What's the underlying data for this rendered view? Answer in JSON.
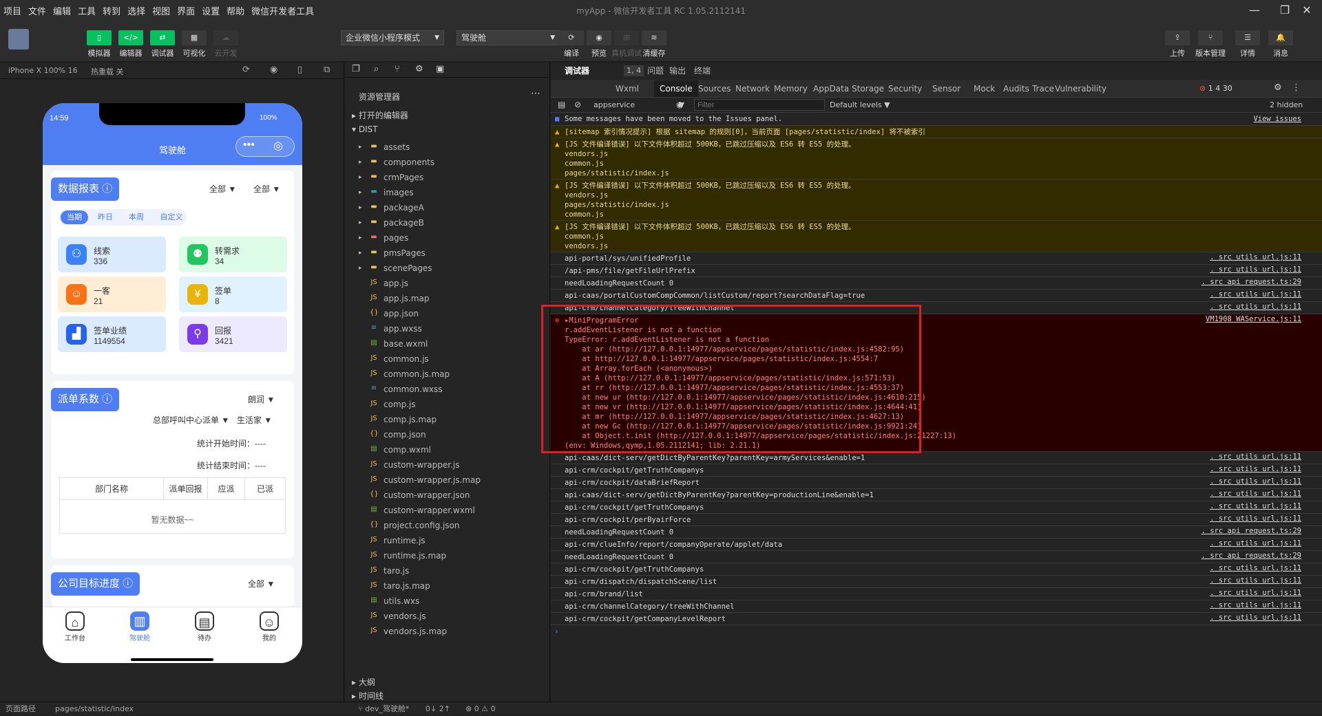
{
  "menu": [
    "项目",
    "文件",
    "编辑",
    "工具",
    "转到",
    "选择",
    "视图",
    "界面",
    "设置",
    "帮助",
    "微信开发者工具"
  ],
  "window_title": "myApp - 微信开发者工具 RC 1.05.2112141",
  "toolbar": {
    "left": [
      "模拟器",
      "编辑器",
      "调试器",
      "可视化",
      "云开发"
    ],
    "mode_select": "企业微信小程序模式",
    "page_select": "驾驶舱",
    "mid": [
      "编译",
      "预览",
      "真机调试",
      "清缓存"
    ],
    "right": [
      "上传",
      "版本管理",
      "详情",
      "消息"
    ]
  },
  "sim": {
    "device": "iPhone X 100% 16",
    "hotreload": "热重载 关",
    "time": "14:59",
    "battery": "100%",
    "nav_title": "驾驶舱",
    "report": {
      "title": "数据报表",
      "filters": [
        "全部",
        "全部"
      ],
      "tabs": [
        "当期",
        "昨日",
        "本周",
        "自定义"
      ],
      "kpis": [
        {
          "label": "线索",
          "value": "336"
        },
        {
          "label": "转需求",
          "value": "34"
        },
        {
          "label": "一客",
          "value": "21"
        },
        {
          "label": "签单",
          "value": "8"
        },
        {
          "label": "签单业绩",
          "value": "1149554"
        },
        {
          "label": "回报",
          "value": "3421"
        }
      ]
    },
    "dispatch": {
      "title": "派单系数",
      "f1": "朗润",
      "f2": "总部呼叫中心派单",
      "f3": "生活家",
      "start": "统计开始时间：----",
      "end": "统计结束时间：----",
      "cols": [
        "部门名称",
        "派单回报",
        "应派",
        "已派"
      ],
      "empty": "暂无数据~~"
    },
    "goal": {
      "title": "公司目标进度",
      "filter": "全部"
    },
    "tabbar": [
      "工作台",
      "驾驶舱",
      "待办",
      "我的"
    ]
  },
  "explorer": {
    "title": "资源管理器",
    "open_editors": "打开的编辑器",
    "root": "DIST",
    "items": [
      "assets",
      "components",
      "crmPages",
      "images",
      "packageA",
      "packageB",
      "pages",
      "pmsPages",
      "scenePages",
      "app.js",
      "app.js.map",
      "app.json",
      "app.wxss",
      "base.wxml",
      "common.js",
      "common.js.map",
      "common.wxss",
      "comp.js",
      "comp.js.map",
      "comp.json",
      "comp.wxml",
      "custom-wrapper.js",
      "custom-wrapper.js.map",
      "custom-wrapper.json",
      "custom-wrapper.wxml",
      "project.config.json",
      "runtime.js",
      "runtime.js.map",
      "taro.js",
      "taro.js.map",
      "utils.wxs",
      "vendors.js",
      "vendors.js.map"
    ],
    "outline": "大纲",
    "timeline": "时间线"
  },
  "devtools": {
    "toptabs": [
      "调试器",
      "1, 4",
      "问题",
      "输出",
      "终端"
    ],
    "tabs": [
      "Wxml",
      "Console",
      "Sources",
      "Network",
      "Memory",
      "AppData",
      "Storage",
      "Security",
      "Sensor",
      "Mock",
      "Audits",
      "Trace",
      "Vulnerability"
    ],
    "counts": "1  4  30",
    "context": "appservice",
    "filter_placeholder": "Filter",
    "levels": "Default levels",
    "hidden": "2 hidden",
    "issues_msg": "Some messages have been moved to the Issues panel.",
    "view_issues": "View issues",
    "logs": [
      {
        "t": "warn",
        "text": "[sitemap 索引情况提示] 根据 sitemap 的规则[0]，当前页面 [pages/statistic/index] 将不被索引",
        "src": ""
      },
      {
        "t": "warn",
        "text": "[JS 文件编译错误] 以下文件体积超过 500KB，已跳过压缩以及 ES6 转 ES5 的处理。\nvendors.js\ncommon.js\npages/statistic/index.js",
        "src": ""
      },
      {
        "t": "warn",
        "text": "[JS 文件编译错误] 以下文件体积超过 500KB，已跳过压缩以及 ES6 转 ES5 的处理。\nvendors.js\npages/statistic/index.js\ncommon.js",
        "src": ""
      },
      {
        "t": "warn",
        "text": "[JS 文件编译错误] 以下文件体积超过 500KB，已跳过压缩以及 ES6 转 ES5 的处理。\ncommon.js\nvendors.js",
        "src": ""
      },
      {
        "t": "log",
        "text": "api-portal/sys/unifiedProfile",
        "src": ". src utils url.js:11"
      },
      {
        "t": "log",
        "text": "/api-pms/file/getFileUrlPrefix",
        "src": ". src utils url.js:11"
      },
      {
        "t": "log",
        "text": "needLoadingRequestCount 0",
        "src": ". src api request.ts:29"
      },
      {
        "t": "log",
        "text": "api-caas/portalCustomCompCommon/listCustom/report?searchDataFlag=true",
        "src": ". src utils url.js:11"
      },
      {
        "t": "log",
        "text": "api-crm/channelCategory/treeWithChannel",
        "src": ". src utils url.js:11"
      },
      {
        "t": "err",
        "text": "▸MiniProgramError\nr.addEventListener is not a function\nTypeError: r.addEventListener is not a function\n    at ar (http://127.0.0.1:14977/appservice/pages/statistic/index.js:4582:95)\n    at http://127.0.0.1:14977/appservice/pages/statistic/index.js:4554:7\n    at Array.forEach (<anonymous>)\n    at A (http://127.0.0.1:14977/appservice/pages/statistic/index.js:571:53)\n    at rr (http://127.0.0.1:14977/appservice/pages/statistic/index.js:4553:37)\n    at new ur (http://127.0.0.1:14977/appservice/pages/statistic/index.js:4610:215)\n    at new vr (http://127.0.0.1:14977/appservice/pages/statistic/index.js:4644:41)\n    at mr (http://127.0.0.1:14977/appservice/pages/statistic/index.js:4627:13)\n    at new Gc (http://127.0.0.1:14977/appservice/pages/statistic/index.js:9921:24)\n    at Object.t.init (http://127.0.0.1:14977/appservice/pages/statistic/index.js:21227:13)\n(env: Windows,qymp,1.05.2112141; lib: 2.21.1)",
        "src": "VM1908 WAService.js:11"
      },
      {
        "t": "log",
        "text": "api-caas/dict-serv/getDictByParentKey?parentKey=armyServices&enable=1",
        "src": ". src utils url.js:11"
      },
      {
        "t": "log",
        "text": "api-crm/cockpit/getTruthCompanys",
        "src": ". src utils url.js:11"
      },
      {
        "t": "log",
        "text": "api-crm/cockpit/dataBriefReport",
        "src": ". src utils url.js:11"
      },
      {
        "t": "log",
        "text": "api-caas/dict-serv/getDictByParentKey?parentKey=productionLine&enable=1",
        "src": ". src utils url.js:11"
      },
      {
        "t": "log",
        "text": "api-crm/cockpit/getTruthCompanys",
        "src": ". src utils url.js:11"
      },
      {
        "t": "log",
        "text": "api-crm/cockpit/perByairForce",
        "src": ". src utils url.js:11"
      },
      {
        "t": "log",
        "text": "needLoadingRequestCount 0",
        "src": ". src api request.ts:29"
      },
      {
        "t": "log",
        "text": "api-crm/clueInfo/report/companyOperate/applet/data",
        "src": ". src utils url.js:11"
      },
      {
        "t": "log",
        "text": "needLoadingRequestCount 0",
        "src": ". src api request.ts:29"
      },
      {
        "t": "log",
        "text": "api-crm/cockpit/getTruthCompanys",
        "src": ". src utils url.js:11"
      },
      {
        "t": "log",
        "text": "api-crm/dispatch/dispatchScene/list",
        "src": ". src utils url.js:11"
      },
      {
        "t": "log",
        "text": "api-crm/brand/list",
        "src": ". src utils url.js:11"
      },
      {
        "t": "log",
        "text": "api-crm/channelCategory/treeWithChannel",
        "src": ". src utils url.js:11"
      },
      {
        "t": "log",
        "text": "api-crm/cockpit/getCompanyLevelReport",
        "src": ". src utils url.js:11"
      }
    ]
  },
  "status": {
    "path_label": "页面路径",
    "path": "pages/statistic/index",
    "branch": "dev_驾驶舱*",
    "sync": "0↓ 2↑",
    "problems": "⊗ 0 ⚠ 0"
  }
}
